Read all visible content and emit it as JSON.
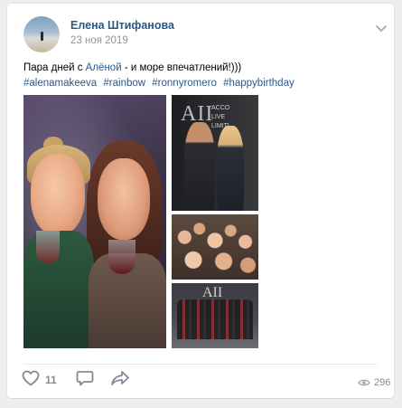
{
  "post": {
    "author": "Елена Штифанова",
    "date": "23 ноя 2019",
    "text_before": "Пара дней с ",
    "mention": "Алёной",
    "text_after": " - и море впечатлений!)))",
    "hashtags": [
      "#alenamakeeva",
      "#rainbow",
      "#ronnyromero",
      "#happybirthday"
    ],
    "photo_logo": "AII",
    "photo_slogan": [
      "ACCO",
      "LIVE",
      "LIMITL"
    ]
  },
  "actions": {
    "likes": "11",
    "views": "296"
  },
  "icons": {
    "menu": "chevron-down-icon",
    "like": "heart-icon",
    "comment": "comment-icon",
    "share": "share-arrow-icon",
    "views": "eye-icon"
  },
  "colors": {
    "link": "#2a5885",
    "muted": "#939393",
    "action": "#828a99",
    "background": "#edeef0"
  }
}
